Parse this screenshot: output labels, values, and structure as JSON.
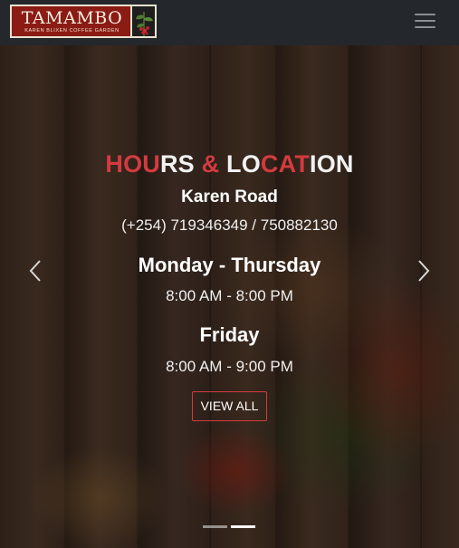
{
  "navbar": {
    "logo": {
      "name": "TAMAMBO",
      "tagline": "KAREN BLIXEN COFFEE GARDEN"
    },
    "toggle_icon": "hamburger-menu-icon"
  },
  "hero": {
    "heading_parts": [
      "HOU",
      "RS",
      " & ",
      "LO",
      "CAT",
      "I",
      "ON"
    ],
    "street": "Karen Road",
    "phone": "(+254) 719346349 / 750882130",
    "schedule": [
      {
        "day": "Monday - Thursday",
        "hours": "8:00 AM - 8:00 PM"
      },
      {
        "day": "Friday",
        "hours": "8:00 AM - 9:00 PM"
      }
    ],
    "button_label": "VIEW ALL",
    "prev_icon": "chevron-left-icon",
    "next_icon": "chevron-right-icon",
    "active_slide": 2,
    "slide_count": 2
  },
  "colors": {
    "accent_red": "#d33b3f",
    "navbar_bg": "#24272b",
    "logo_bg": "#8b1b15"
  }
}
